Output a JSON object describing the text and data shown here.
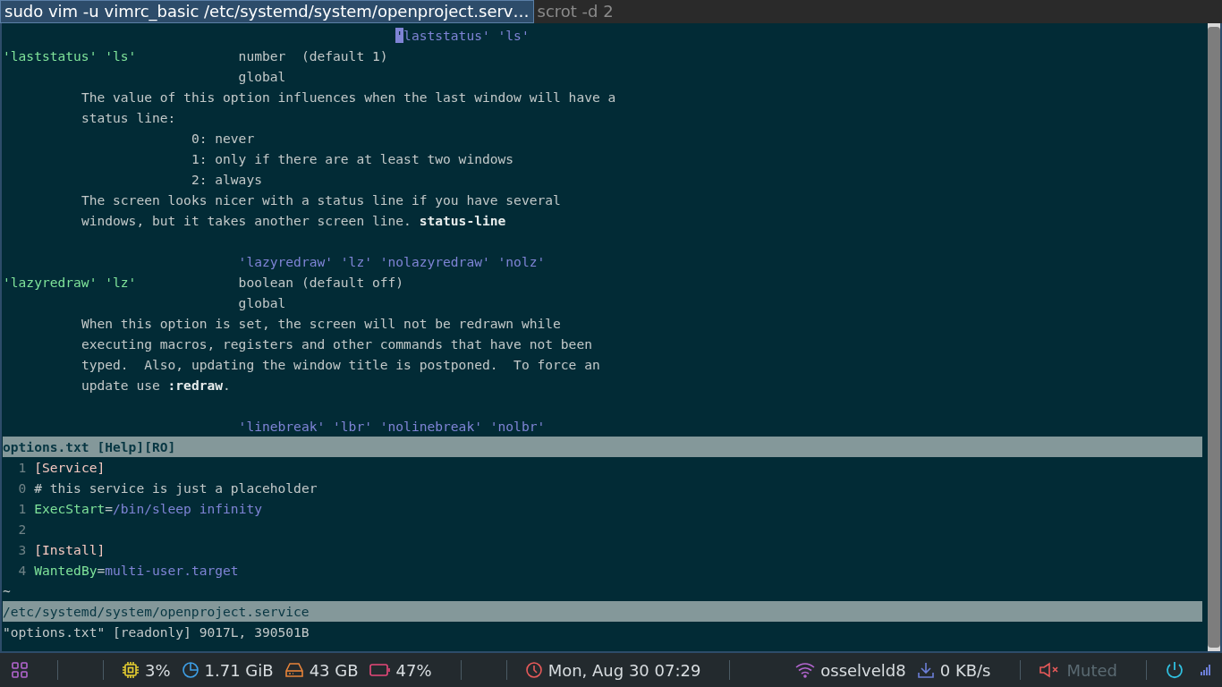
{
  "tabs": [
    {
      "label": "sudo vim -u vimrc_basic /etc/systemd/system/openproject.serv…",
      "selected": true
    },
    {
      "label": "scrot -d 2",
      "selected": false
    }
  ],
  "help_window": {
    "lines": [
      [
        {
          "text": "                                                  '",
          "kind": "cursor"
        },
        {
          "text": "laststatus' 'ls'",
          "kind": "link"
        }
      ],
      [
        {
          "text": "'laststatus' 'ls'",
          "kind": "tag"
        },
        {
          "text": "             number  (default 1)",
          "kind": "plain"
        }
      ],
      [
        {
          "text": "                              global",
          "kind": "plain"
        }
      ],
      [
        {
          "text": "          The value of this option influences when the last window will have a",
          "kind": "plain"
        }
      ],
      [
        {
          "text": "          status line:",
          "kind": "plain"
        }
      ],
      [
        {
          "text": "                        0: never",
          "kind": "plain"
        }
      ],
      [
        {
          "text": "                        1: only if there are at least two windows",
          "kind": "plain"
        }
      ],
      [
        {
          "text": "                        2: always",
          "kind": "plain"
        }
      ],
      [
        {
          "text": "          The screen looks nicer with a status line if you have several",
          "kind": "plain"
        }
      ],
      [
        {
          "text": "          windows, but it takes another screen line. ",
          "kind": "plain"
        },
        {
          "text": "status-line",
          "kind": "bold"
        }
      ],
      {
        "kind": "blank"
      },
      [
        {
          "text": "                              'lazyredraw' 'lz' 'nolazyredraw' 'nolz'",
          "kind": "link"
        }
      ],
      [
        {
          "text": "'lazyredraw' 'lz'",
          "kind": "tag"
        },
        {
          "text": "             boolean (default off)",
          "kind": "plain"
        }
      ],
      [
        {
          "text": "                              global",
          "kind": "plain"
        }
      ],
      [
        {
          "text": "          When this option is set, the screen will not be redrawn while",
          "kind": "plain"
        }
      ],
      [
        {
          "text": "          executing macros, registers and other commands that have not been",
          "kind": "plain"
        }
      ],
      [
        {
          "text": "          typed.  Also, updating the window title is postponed.  To force an",
          "kind": "plain"
        }
      ],
      [
        {
          "text": "          update use ",
          "kind": "plain"
        },
        {
          "text": ":redraw",
          "kind": "bold"
        },
        {
          "text": ".",
          "kind": "plain"
        }
      ],
      {
        "kind": "blank"
      },
      [
        {
          "text": "                              'linebreak' 'lbr' 'nolinebreak' 'nolbr'",
          "kind": "link"
        }
      ]
    ],
    "status": "options.txt [Help][RO]"
  },
  "file_window": {
    "lines": [
      {
        "number": "1",
        "segments": [
          {
            "text": "[Service]",
            "kind": "section"
          }
        ]
      },
      {
        "number": "0",
        "segments": [
          {
            "text": "# this service is just a placeholder",
            "kind": "plain"
          }
        ]
      },
      {
        "number": "1",
        "segments": [
          {
            "text": "ExecStart",
            "kind": "key"
          },
          {
            "text": "=",
            "kind": "plain"
          },
          {
            "text": "/bin/sleep infinity",
            "kind": "link"
          }
        ]
      },
      {
        "number": "2"
      },
      {
        "number": "3",
        "segments": [
          {
            "text": "[Install]",
            "kind": "section"
          }
        ]
      },
      {
        "number": "4",
        "segments": [
          {
            "text": "WantedBy",
            "kind": "key"
          },
          {
            "text": "=",
            "kind": "plain"
          },
          {
            "text": "multi-user.target",
            "kind": "link"
          }
        ]
      }
    ],
    "filler": [
      "~"
    ],
    "status": "/etc/systemd/system/openproject.service"
  },
  "command_line": "\"options.txt\" [readonly] 9017L, 390501B",
  "panel": {
    "items": [
      {
        "kind": "launcher"
      },
      {
        "kind": "separator"
      },
      {
        "kind": "gap"
      },
      {
        "kind": "separator"
      },
      {
        "kind": "cpu",
        "text": "3%"
      },
      {
        "kind": "memory",
        "text": "1.71 GiB"
      },
      {
        "kind": "disk",
        "text": "43 GB"
      },
      {
        "kind": "battery",
        "text": "47%"
      },
      {
        "kind": "separator"
      },
      {
        "kind": "gap"
      },
      {
        "kind": "separator"
      },
      {
        "kind": "clock",
        "text": "Mon, Aug 30 07:29"
      },
      {
        "kind": "separator"
      },
      {
        "kind": "spacer"
      },
      {
        "kind": "wifi",
        "text": "osselveld8"
      },
      {
        "kind": "network",
        "text": "0 KB/s"
      },
      {
        "kind": "separator"
      },
      {
        "kind": "volume",
        "text": "Muted",
        "muted": true
      },
      {
        "kind": "separator"
      },
      {
        "kind": "power"
      },
      {
        "kind": "signal"
      }
    ]
  }
}
